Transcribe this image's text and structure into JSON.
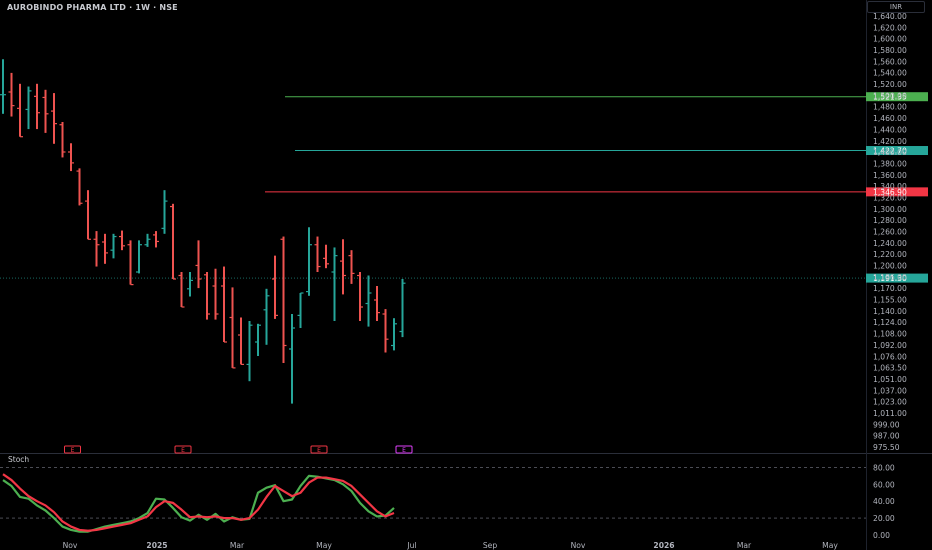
{
  "header": {
    "title": "AUROBINDO PHARMA LTD · 1W · NSE",
    "currency": "INR"
  },
  "colors": {
    "up": "#26a69a",
    "down": "#ef5350",
    "stoch_k": "#4caf50",
    "stoch_d": "#f23645",
    "background": "#000000",
    "axis_text": "#b2b5be",
    "green_line": "#4caf50",
    "teal_line": "#26a69a",
    "red_line": "#f23645",
    "earnings_marker": "#f23645",
    "dividend_marker": "#e040fb"
  },
  "chart_data": [
    {
      "type": "ohlc",
      "title": "AUROBINDO PHARMA LTD · 1W · NSE",
      "y_axis_ticks": [
        "1,640.00",
        "1,620.00",
        "1,600.00",
        "1,580.00",
        "1,560.00",
        "1,540.00",
        "1,520.00",
        "1,500.00",
        "1,480.00",
        "1,460.00",
        "1,440.00",
        "1,420.00",
        "1,400.00",
        "1,380.00",
        "1,360.00",
        "1,340.00",
        "1,320.00",
        "1,300.00",
        "1,280.00",
        "1,260.00",
        "1,240.00",
        "1,220.00",
        "1,200.00",
        "1,186.00",
        "1,170.00",
        "1,155.00",
        "1,140.00",
        "1,124.00",
        "1,108.00",
        "1,092.00",
        "1,076.00",
        "1,063.50",
        "1,051.00",
        "1,037.00",
        "1,023.00",
        "1,011.00",
        "999.00",
        "987.00",
        "975.50"
      ],
      "x_axis_ticks": [
        "Nov",
        "2025",
        "Mar",
        "May",
        "Jul",
        "Sep",
        "Nov",
        "2026",
        "Mar",
        "May"
      ],
      "candles": [
        {
          "o": 1525,
          "h": 1590,
          "l": 1490,
          "c": 1525
        },
        {
          "o": 1530,
          "h": 1565,
          "l": 1485,
          "c": 1505
        },
        {
          "o": 1500,
          "h": 1545,
          "l": 1448,
          "c": 1448
        },
        {
          "o": 1498,
          "h": 1540,
          "l": 1462,
          "c": 1532
        },
        {
          "o": 1522,
          "h": 1545,
          "l": 1462,
          "c": 1492
        },
        {
          "o": 1520,
          "h": 1534,
          "l": 1455,
          "c": 1490
        },
        {
          "o": 1495,
          "h": 1528,
          "l": 1435,
          "c": 1472
        },
        {
          "o": 1470,
          "h": 1475,
          "l": 1410,
          "c": 1420
        },
        {
          "o": 1420,
          "h": 1436,
          "l": 1385,
          "c": 1400
        },
        {
          "o": 1385,
          "h": 1390,
          "l": 1322,
          "c": 1326
        },
        {
          "o": 1330,
          "h": 1350,
          "l": 1260,
          "c": 1260
        },
        {
          "o": 1260,
          "h": 1275,
          "l": 1210,
          "c": 1250
        },
        {
          "o": 1255,
          "h": 1270,
          "l": 1215,
          "c": 1235
        },
        {
          "o": 1240,
          "h": 1270,
          "l": 1225,
          "c": 1265
        },
        {
          "o": 1265,
          "h": 1276,
          "l": 1240,
          "c": 1248
        },
        {
          "o": 1250,
          "h": 1258,
          "l": 1182,
          "c": 1182
        },
        {
          "o": 1200,
          "h": 1258,
          "l": 1198,
          "c": 1250
        },
        {
          "o": 1250,
          "h": 1270,
          "l": 1246,
          "c": 1260
        },
        {
          "o": 1268,
          "h": 1275,
          "l": 1245,
          "c": 1256
        },
        {
          "o": 1280,
          "h": 1350,
          "l": 1270,
          "c": 1330
        },
        {
          "o": 1320,
          "h": 1325,
          "l": 1190,
          "c": 1190
        },
        {
          "o": 1195,
          "h": 1200,
          "l": 1150,
          "c": 1150
        },
        {
          "o": 1176,
          "h": 1200,
          "l": 1165,
          "c": 1188
        },
        {
          "o": 1212,
          "h": 1258,
          "l": 1177,
          "c": 1190
        },
        {
          "o": 1196,
          "h": 1200,
          "l": 1132,
          "c": 1140
        },
        {
          "o": 1180,
          "h": 1206,
          "l": 1132,
          "c": 1140
        },
        {
          "o": 1180,
          "h": 1210,
          "l": 1100,
          "c": 1100
        },
        {
          "o": 1135,
          "h": 1178,
          "l": 1063,
          "c": 1063
        },
        {
          "o": 1110,
          "h": 1135,
          "l": 1068,
          "c": 1068
        },
        {
          "o": 1068,
          "h": 1130,
          "l": 1044,
          "c": 1124
        },
        {
          "o": 1100,
          "h": 1126,
          "l": 1080,
          "c": 1124
        },
        {
          "o": 1146,
          "h": 1176,
          "l": 1096,
          "c": 1166
        },
        {
          "o": 1190,
          "h": 1230,
          "l": 1133,
          "c": 1138
        },
        {
          "o": 1260,
          "h": 1265,
          "l": 1070,
          "c": 1095
        },
        {
          "o": 1090,
          "h": 1140,
          "l": 1012,
          "c": 1120
        },
        {
          "o": 1138,
          "h": 1170,
          "l": 1120,
          "c": 1170
        },
        {
          "o": 1172,
          "h": 1282,
          "l": 1166,
          "c": 1250
        },
        {
          "o": 1250,
          "h": 1265,
          "l": 1200,
          "c": 1210
        },
        {
          "o": 1225,
          "h": 1250,
          "l": 1207,
          "c": 1215
        },
        {
          "o": 1200,
          "h": 1245,
          "l": 1130,
          "c": 1230
        },
        {
          "o": 1220,
          "h": 1260,
          "l": 1168,
          "c": 1195
        },
        {
          "o": 1230,
          "h": 1240,
          "l": 1183,
          "c": 1198
        },
        {
          "o": 1195,
          "h": 1200,
          "l": 1130,
          "c": 1150
        },
        {
          "o": 1155,
          "h": 1195,
          "l": 1122,
          "c": 1170
        },
        {
          "o": 1160,
          "h": 1180,
          "l": 1130,
          "c": 1142
        },
        {
          "o": 1140,
          "h": 1147,
          "l": 1085,
          "c": 1104
        },
        {
          "o": 1095,
          "h": 1134,
          "l": 1088,
          "c": 1126
        },
        {
          "o": 1115,
          "h": 1190,
          "l": 1107,
          "c": 1184
        }
      ],
      "horizontal_levels": [
        {
          "value": 1521.35,
          "label": "1,521.35",
          "color_key": "green_line"
        },
        {
          "value": 1422.7,
          "label": "1,422.70",
          "color_key": "teal_line"
        },
        {
          "value": 1346.9,
          "label": "1,346.90",
          "color_key": "red_line"
        }
      ],
      "last_price": {
        "value": 1191.3,
        "label": "1,191.30"
      },
      "event_markers": [
        {
          "label": "E",
          "kind": "earnings",
          "index": 7
        },
        {
          "label": "E",
          "kind": "earnings",
          "index": 20
        },
        {
          "label": "E",
          "kind": "earnings",
          "index": 36
        },
        {
          "label": "E",
          "kind": "dividend",
          "index": 46
        }
      ]
    },
    {
      "type": "line",
      "title": "Stoch",
      "y_axis_ticks": [
        "80.00",
        "60.00",
        "40.00",
        "20.00",
        "0.00"
      ],
      "ylim": [
        0,
        80
      ],
      "bands": [
        80,
        20
      ],
      "series": [
        {
          "color_key": "stoch_k",
          "values": [
            65,
            58,
            45,
            43,
            35,
            29,
            20,
            10,
            6,
            4,
            4,
            7,
            10,
            12,
            14,
            16,
            20,
            26,
            43,
            42,
            32,
            21,
            17,
            24,
            18,
            25,
            16,
            21,
            18,
            19,
            50,
            56,
            59,
            40,
            42,
            58,
            70,
            69,
            67,
            65,
            60,
            52,
            38,
            28,
            22,
            23,
            32
          ]
        },
        {
          "color_key": "stoch_d",
          "values": [
            72,
            65,
            55,
            46,
            40,
            35,
            27,
            16,
            10,
            6,
            5,
            6,
            8,
            10,
            12,
            14,
            18,
            22,
            33,
            40,
            38,
            30,
            21,
            22,
            21,
            22,
            20,
            20,
            18,
            20,
            30,
            45,
            58,
            52,
            46,
            50,
            62,
            68,
            68,
            66,
            64,
            58,
            48,
            38,
            28,
            22,
            26
          ]
        }
      ]
    }
  ]
}
